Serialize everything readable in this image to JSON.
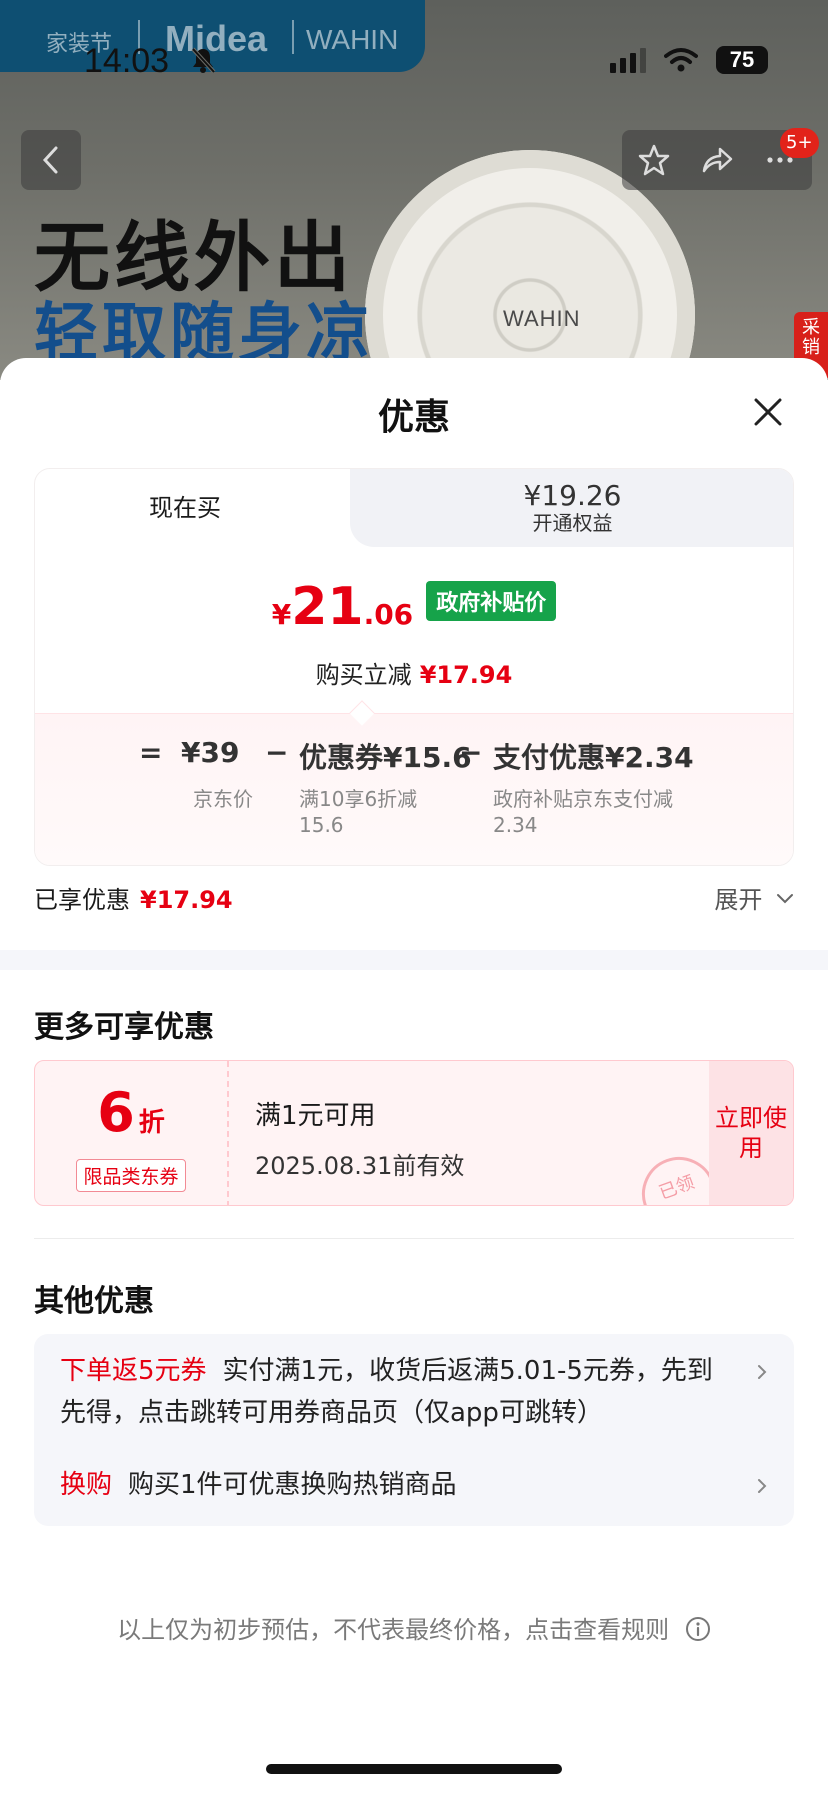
{
  "status_bar": {
    "time": "14:03",
    "battery": "75"
  },
  "banner": {
    "brand_left": "家装节",
    "brand_main": "Midea",
    "brand_right": "WAHIN",
    "headline": "无线外出",
    "subheadline": "轻取随身凉",
    "product_logo": "WAHIN",
    "side_tag": "采销",
    "notification_badge": "5+",
    "icons": [
      "chevron-left-icon",
      "star-icon",
      "share-icon",
      "more-icon"
    ]
  },
  "sheet": {
    "title": "优惠",
    "tabs": {
      "now_label": "现在买",
      "member_price": "¥19.26",
      "member_label": "开通权益"
    },
    "price": {
      "currency": "¥",
      "integer": "21",
      "decimal": ".06",
      "badge": "政府补贴价",
      "instant_label": "购买立减",
      "instant_amount": "¥17.94"
    },
    "breakdown": {
      "equals": "=",
      "minus": "−",
      "jd_price": "¥39",
      "jd_label": "京东价",
      "coupon": "优惠券¥15.6",
      "coupon_desc": "满10享6折减15.6",
      "payment": "支付优惠¥2.34",
      "payment_desc": "政府补贴京东支付减2.34"
    },
    "enjoyed_label": "已享优惠",
    "enjoyed_amount": "¥17.94",
    "expand_label": "展开",
    "more_title": "更多可享优惠",
    "coupon_card": {
      "discount": "6",
      "discount_unit": "折",
      "scope": "限品类东券",
      "condition": "满1元可用",
      "expiry": "2025.08.31前有效",
      "stamp": "已领",
      "action": "立即使用"
    },
    "other_title": "其他优惠",
    "other_items": [
      {
        "tag": "下单返5元券",
        "text": "实付满1元，收货后返满5.01-5元券，先到先得，点击跳转可用券商品页（仅app可跳转）"
      },
      {
        "tag": "换购",
        "text": "购买1件可优惠换购热销商品"
      }
    ],
    "disclaimer": "以上仅为初步预估，不代表最终价格，点击查看规则"
  },
  "colors": {
    "accent_red": "#e60012",
    "gov_green": "#16a34a",
    "brand_blue": "#134e8c"
  }
}
